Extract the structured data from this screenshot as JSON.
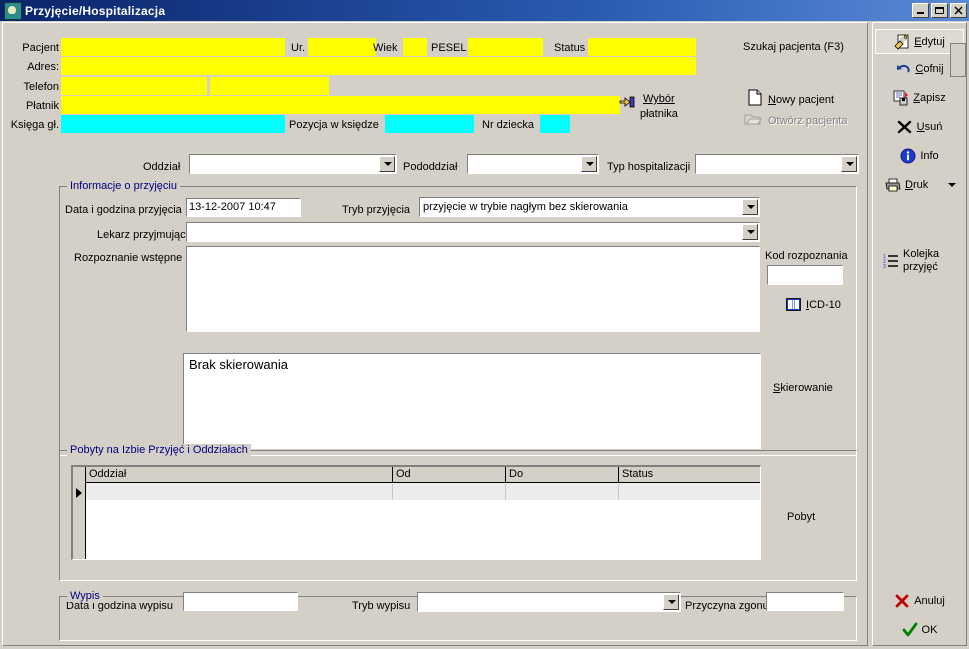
{
  "window": {
    "title": "Przyjęcie/Hospitalizacja",
    "icon": "app-icon",
    "minimize": "_",
    "maximize": "□",
    "close": "✕"
  },
  "patient": {
    "label_pacjent": "Pacjent",
    "value_pacjent": "",
    "label_ur": "Ur.",
    "value_ur": "",
    "label_wiek": "Wiek",
    "value_wiek": "",
    "label_pesel": "PESEL",
    "value_pesel": "",
    "label_status": "Status",
    "value_status": "",
    "label_adres": "Adres:",
    "value_adres": "",
    "label_telefon": "Telefon",
    "value_telefon1": "",
    "value_telefon2": "",
    "label_platnik": "Płatnik",
    "value_platnik": "",
    "label_ksiega": "Księga gł.",
    "value_ksiega": "",
    "label_pozycja": "Pozycja w księdze",
    "value_pozycja": "",
    "label_nr_dziecka": "Nr dziecka",
    "value_nr_dziecka": ""
  },
  "actions": {
    "wybor_platnika": "Wybór\npłatnika",
    "wybor_platnika_line1": "Wybór",
    "wybor_platnika_line2": "płatnika",
    "szukaj_pacjenta": "Szukaj pacjenta (F3)",
    "nowy_pacjent": "Nowy pacjent",
    "nowy_pacjent_accel": "N",
    "otworz_pacjenta": "Otwórz pacjenta",
    "otworz_pacjenta_accel": "O",
    "otworz_pacjenta_enabled": false
  },
  "ward": {
    "label_oddzial": "Oddział",
    "value_oddzial": "",
    "label_pododdzial": "Pododdział",
    "value_pododdzial": "",
    "label_typ": "Typ hospitalizacji",
    "value_typ": ""
  },
  "admission": {
    "group_title": "Informacje o przyjęciu",
    "label_data": "Data i godzina przyjęcia",
    "value_data": "13-12-2007 10:47",
    "label_tryb": "Tryb przyjęcia",
    "value_tryb": "przyjęcie w trybie nagłym bez skierowania",
    "label_lekarz": "Lekarz przyjmujący",
    "value_lekarz": "",
    "label_rozpoznanie": "Rozpoznanie wstępne",
    "value_rozpoznanie": "",
    "label_kod": "Kod rozpoznania",
    "value_kod": "",
    "icd_label": "ICD-10",
    "icd_accel": "I",
    "label_skierowanie": "Skierowanie",
    "skierowanie_accel": "S",
    "value_skierowanie_memo": "Brak skierowania"
  },
  "stays": {
    "group_title": "Pobyty na Izbie Przyjęć i Oddziałach",
    "columns": [
      "Oddział",
      "Od",
      "Do",
      "Status"
    ],
    "rows": [
      {
        "Oddział": "",
        "Od": "",
        "Do": "",
        "Status": ""
      }
    ],
    "side_label": "Pobyt"
  },
  "discharge": {
    "group_title": "Wypis",
    "label_data": "Data i godzina wypisu",
    "value_data": "",
    "label_tryb": "Tryb wypisu",
    "value_tryb": "",
    "label_przyczyna": "Przyczyna zgonu",
    "value_przyczyna": ""
  },
  "sidebar": {
    "items": [
      {
        "label": "Edytuj",
        "accel": "E",
        "icon": "edit-icon",
        "state": "hot"
      },
      {
        "label": "Cofnij",
        "accel": "C",
        "icon": "undo-icon",
        "state": "normal"
      },
      {
        "label": "Zapisz",
        "accel": "Z",
        "icon": "save-icon",
        "state": "normal"
      },
      {
        "label": "Usuń",
        "accel": "U",
        "icon": "delete-icon",
        "state": "normal"
      },
      {
        "label": "Info",
        "accel": "",
        "icon": "info-icon",
        "state": "normal"
      },
      {
        "label": "Druk",
        "accel": "D",
        "icon": "print-icon",
        "state": "normal"
      },
      {
        "label": "Kolejka\nprzyjęć",
        "label_line1": "Kolejka",
        "label_line2": "przyjęć",
        "accel": "K",
        "icon": "queue-icon",
        "state": "normal"
      }
    ],
    "bottom": [
      {
        "label": "Anuluj",
        "icon": "cancel-x-icon"
      },
      {
        "label": "OK",
        "icon": "ok-check-icon"
      }
    ]
  },
  "colors": {
    "face": "#d4d0c8",
    "yellow_field": "#ffff00",
    "cyan_field": "#00ffff",
    "group_title": "#00007f",
    "title_bar_start": "#0a246a",
    "title_bar_end": "#5a8ad6"
  }
}
